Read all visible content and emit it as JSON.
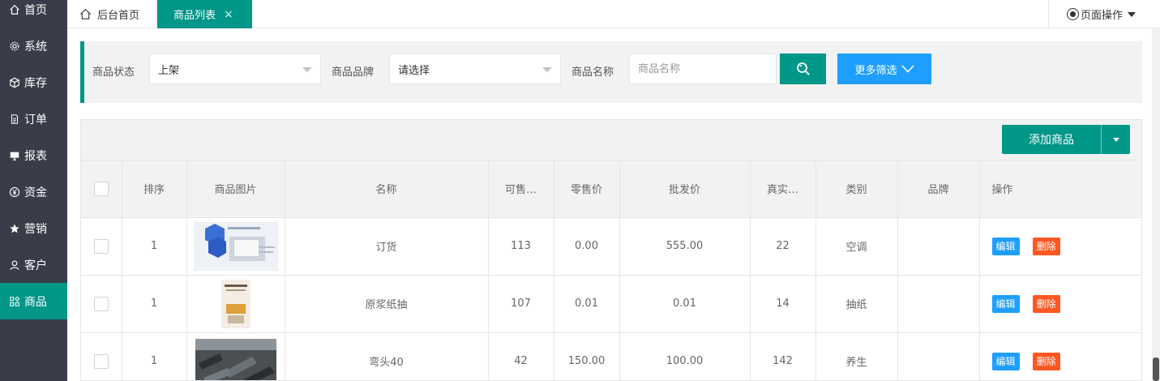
{
  "sidebar": {
    "items": [
      {
        "label": "首页",
        "icon": "home-icon"
      },
      {
        "label": "系统",
        "icon": "gear-icon"
      },
      {
        "label": "库存",
        "icon": "cube-icon"
      },
      {
        "label": "订单",
        "icon": "document-icon"
      },
      {
        "label": "报表",
        "icon": "monitor-icon"
      },
      {
        "label": "资金",
        "icon": "yen-icon"
      },
      {
        "label": "营销",
        "icon": "star-icon"
      },
      {
        "label": "客户",
        "icon": "user-icon"
      },
      {
        "label": "商品",
        "icon": "apps-icon",
        "active": true
      }
    ]
  },
  "tabs": {
    "home": "后台首页",
    "active": "商品列表",
    "close": "×",
    "page_ops": "页面操作"
  },
  "filter": {
    "status_label": "商品状态",
    "status_value": "上架",
    "brand_label": "商品品牌",
    "brand_value": "请选择",
    "name_label": "商品名称",
    "name_placeholder": "商品名称",
    "more_label": "更多筛选"
  },
  "toolbar": {
    "add_label": "添加商品"
  },
  "table": {
    "headers": [
      "排序",
      "商品图片",
      "名称",
      "可售…",
      "零售价",
      "批发价",
      "真实…",
      "类别",
      "品牌",
      "操作"
    ],
    "edit_label": "编辑",
    "delete_label": "删除",
    "rows": [
      {
        "sort": "1",
        "name": "订货",
        "stock": "113",
        "retail": "0.00",
        "wholesale": "555.00",
        "real": "22",
        "category": "空调",
        "brand": ""
      },
      {
        "sort": "1",
        "name": "原浆纸抽",
        "stock": "107",
        "retail": "0.01",
        "wholesale": "0.01",
        "real": "14",
        "category": "抽纸",
        "brand": ""
      },
      {
        "sort": "1",
        "name": "弯头40",
        "stock": "42",
        "retail": "150.00",
        "wholesale": "100.00",
        "real": "142",
        "category": "养生",
        "brand": ""
      }
    ]
  },
  "colors": {
    "sidebar_bg": "#393d49",
    "primary": "#009688",
    "blue": "#1e9fff",
    "danger": "#ff5722"
  }
}
